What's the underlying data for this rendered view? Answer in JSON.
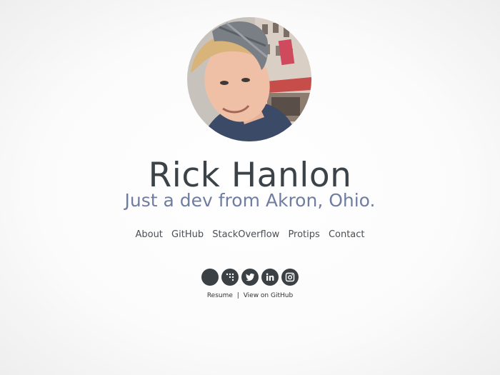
{
  "profile": {
    "name": "Rick Hanlon",
    "tagline": "Just a dev from Akron, Ohio."
  },
  "nav": {
    "items": [
      "About",
      "GitHub",
      "StackOverflow",
      "Protips",
      "Contact"
    ]
  },
  "social": {
    "icons": [
      "github-icon",
      "coderwall-icon",
      "twitter-icon",
      "linkedin-icon",
      "instagram-icon"
    ]
  },
  "footer_links": {
    "resume": "Resume",
    "separator": "|",
    "github": "View on GitHub"
  },
  "colors": {
    "name": "#3c4348",
    "tagline": "#6f7da0",
    "icon_bg": "#3b4044"
  }
}
